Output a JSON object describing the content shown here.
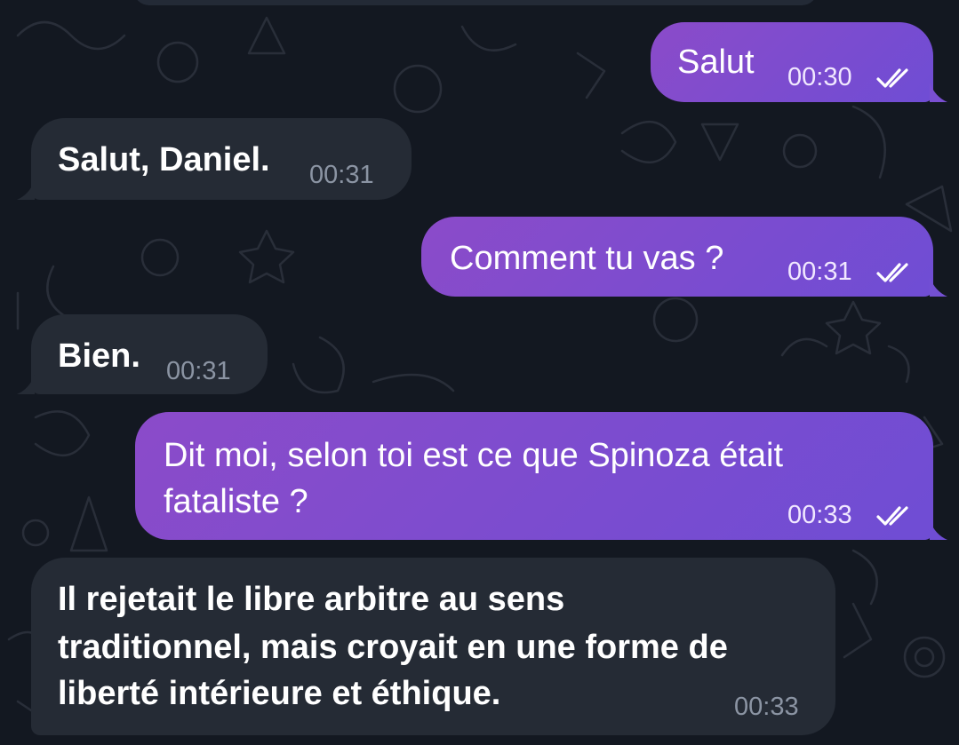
{
  "chat": {
    "messages": [
      {
        "direction": "out",
        "text_lines": [
          "Salut"
        ],
        "time": "00:30",
        "status_icon": "double-check-read-icon"
      },
      {
        "direction": "in",
        "text_lines": [
          "Salut, Daniel."
        ],
        "time": "00:31"
      },
      {
        "direction": "out",
        "text_lines": [
          "Comment tu vas ?"
        ],
        "time": "00:31",
        "status_icon": "double-check-read-icon"
      },
      {
        "direction": "in",
        "text_lines": [
          "Bien."
        ],
        "time": "00:31"
      },
      {
        "direction": "out",
        "text_lines": [
          "Dit moi, selon toi est ce que Spinoza était",
          "fataliste ?"
        ],
        "time": "00:33",
        "status_icon": "double-check-read-icon"
      },
      {
        "direction": "in",
        "text_lines": [
          "Il rejetait le libre arbitre au sens",
          "traditionnel, mais croyait en une forme de",
          "liberté intérieure et éthique."
        ],
        "time": "00:33"
      }
    ]
  },
  "colors": {
    "background": "#131821",
    "outgoing_bubble_start": "#8b4bc9",
    "outgoing_bubble_end": "#6f4dd4",
    "incoming_bubble": "#252b35",
    "incoming_time": "#8b94a3",
    "text": "#ffffff"
  }
}
